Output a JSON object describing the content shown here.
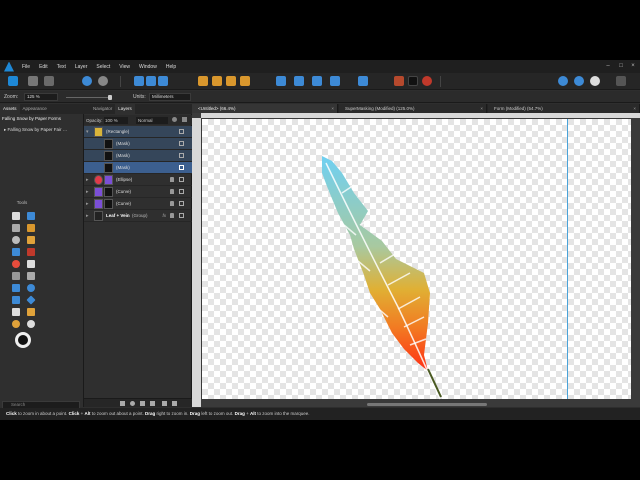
{
  "menu": [
    "File",
    "Edit",
    "Text",
    "Layer",
    "Select",
    "View",
    "Window",
    "Help"
  ],
  "context": {
    "zoom_label": "Zoom:",
    "zoom_value": "125 %",
    "units_label": "Units:",
    "units_value": "Millimeters"
  },
  "left_panel": {
    "tabs": [
      "Assets",
      "Appearance"
    ],
    "asset_dropdown": "Falling Snow by Paper Forms",
    "asset_item": "Falling Snow by Paper Fair …",
    "tools_title": "Tools",
    "search_placeholder": "Search"
  },
  "layers_panel": {
    "tabs": [
      "Navigator",
      "Layers"
    ],
    "opacity_label": "Opacity:",
    "opacity_value": "100 %",
    "blend_mode": "Normal",
    "rows": [
      {
        "name": "(Rectangle)"
      },
      {
        "name": "(Mask)"
      },
      {
        "name": "(Mask)"
      },
      {
        "name": "(Mask)"
      },
      {
        "name": "(Ellipse)"
      },
      {
        "name": "(Curve)"
      },
      {
        "name": "(Curve)"
      },
      {
        "name": "Leaf + Vein",
        "suffix": "(Group)"
      }
    ]
  },
  "document_tabs": [
    {
      "label": "<Untitled> (66.4%)"
    },
    {
      "label": "SuperMasking (Modified) (125.0%)"
    },
    {
      "label": "Form (Modified) (54.7%)"
    }
  ],
  "status": {
    "p1_bold": "Click",
    "p1": " to zoom in about a point. ",
    "p2_bold": "Click",
    "p2_mid": " + ",
    "p2_bold2": "Alt",
    "p2": " to zoom out about a point. ",
    "p3_bold": "Drag",
    "p3": " right to zoom in. ",
    "p4_bold": "Drag",
    "p4": " left to zoom out. ",
    "p5_bold": "Drag",
    "p5_mid": " + ",
    "p5_bold2": "Alt",
    "p5": " to zoom into the marquee."
  },
  "colors": {
    "accent": "#1e88d6",
    "feather_top": "#6fd0f2",
    "feather_mid": "#d8b53a",
    "feather_bottom": "#ff3a1a"
  }
}
